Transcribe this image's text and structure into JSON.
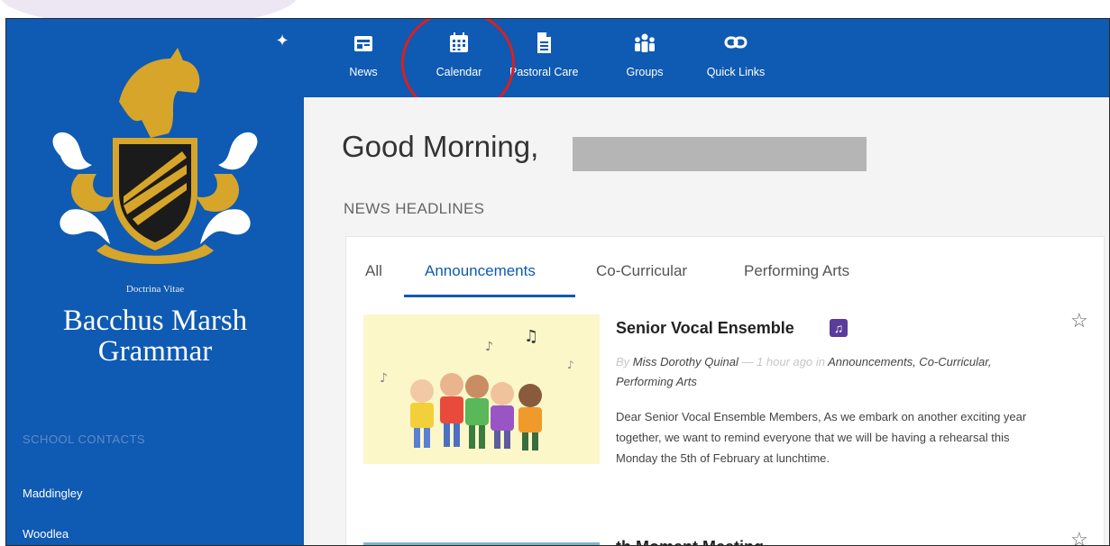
{
  "sidebar": {
    "motto": "Doctrina Vitae",
    "school_name_line1": "Bacchus Marsh",
    "school_name_line2": "Grammar",
    "contacts_heading": "SCHOOL CONTACTS",
    "contacts": [
      "Maddingley",
      "Woodlea"
    ]
  },
  "nav": {
    "items": [
      {
        "label": "News",
        "icon": "news-icon"
      },
      {
        "label": "Calendar",
        "icon": "calendar-icon"
      },
      {
        "label": "Pastoral Care",
        "icon": "document-icon"
      },
      {
        "label": "Groups",
        "icon": "groups-icon"
      },
      {
        "label": "Quick Links",
        "icon": "link-icon"
      }
    ]
  },
  "main": {
    "greeting": "Good Morning,",
    "news_heading": "NEWS HEADLINES",
    "tabs": [
      "All",
      "Announcements",
      "Co-Curricular",
      "Performing Arts"
    ],
    "active_tab": "Announcements",
    "posts": [
      {
        "title": "Senior Vocal Ensemble",
        "by_prefix": "By",
        "author": "Miss Dorothy Quinal",
        "time": "— 1 hour ago in",
        "categories": "Announcements, Co-Curricular, Performing Arts",
        "excerpt": "Dear Senior Vocal Ensemble Members, As we embark on another exciting year together, we want to remind everyone that we will be having a rehearsal this Monday the 5th of February at lunchtime."
      },
      {
        "title": "th Moment Meeting"
      }
    ]
  },
  "colors": {
    "brand_blue": "#0f5ab2",
    "crest_gold": "#d6a52a",
    "highlight_red": "#d8211f"
  }
}
